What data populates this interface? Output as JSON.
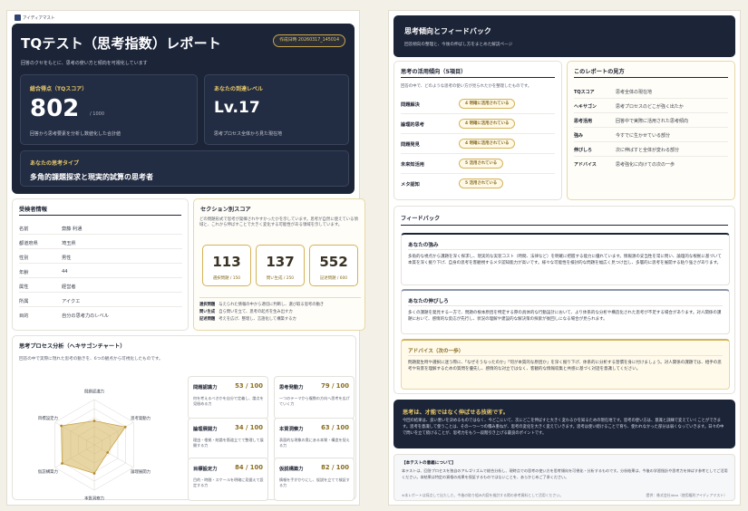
{
  "brand": "アイディアマスト",
  "report": {
    "title": "TQテスト（思考指数）レポート",
    "subtitle": "回答のクセをもとに、思考の使い方と傾向を可視化しています",
    "badge": "作成日時 20260317_145014"
  },
  "score": {
    "label": "総合得点（TQスコア）",
    "value": "802",
    "max": "/ 1000",
    "note": "回答から思考要素を分析し数値化した合計値"
  },
  "level": {
    "label": "あなたの到達レベル",
    "value": "Lv.17",
    "note": "思考プロセス全体から見た現在地"
  },
  "type": {
    "label": "あなたの思考タイプ",
    "value": "多角的課題探求と現実的試算の思考者"
  },
  "profile": {
    "title": "受検者情報",
    "rows": [
      {
        "k": "名前",
        "v": "齋藤 利通"
      },
      {
        "k": "都道府県",
        "v": "埼玉県"
      },
      {
        "k": "性別",
        "v": "男性"
      },
      {
        "k": "年齢",
        "v": "44"
      },
      {
        "k": "属性",
        "v": "経営者"
      },
      {
        "k": "所属",
        "v": "アイクエ"
      },
      {
        "k": "目的",
        "v": "自分の思考力のレベル"
      }
    ]
  },
  "sections": {
    "title": "セクション別スコア",
    "desc": "どの問題形式で思考が発揮されやすかったかを示しています。思考が自然に使えている領域と、これから伸ばすことで大きく変化する可能性がある領域を示しています。",
    "items": [
      {
        "value": "113",
        "label": "選択問題 / 150"
      },
      {
        "value": "137",
        "label": "問い生成 / 250"
      },
      {
        "value": "552",
        "label": "記述問題 / 600"
      }
    ],
    "notes": [
      {
        "k": "選択問題",
        "v": "与えられた情報の中から適切に判断し、選び取る思考の動き"
      },
      {
        "k": "問い生成",
        "v": "自ら問いを立て、思考の起点を生み出す力"
      },
      {
        "k": "記述問題",
        "v": "考えを広げ、整理し、言語化して構築する力"
      }
    ]
  },
  "hexagon": {
    "title": "思考プロセス分析（ヘキサゴンチャート）",
    "desc": "回答の中で実際に現れた思考の動きを、6つの観点から可視化したものです。",
    "axes": [
      "問題認識力",
      "思考発動力",
      "論理展開力",
      "本質洞察力",
      "仮説構築力",
      "目標設定力"
    ],
    "cards": [
      {
        "t": "問題認識力",
        "s": "53 / 100",
        "d": "何を考えるべきかを自分で定義し、論点を見極める力"
      },
      {
        "t": "思考発動力",
        "s": "79 / 100",
        "d": "一つのテーマから複数の方向へ思考を広げていく力"
      },
      {
        "t": "論理展開力",
        "s": "34 / 100",
        "d": "理由・根拠・結論を筋道立てて整理して展開する力"
      },
      {
        "t": "本質洞察力",
        "s": "63 / 100",
        "d": "表面的な現象の奥にある本質・構造を捉える力"
      },
      {
        "t": "目標設定力",
        "s": "84 / 100",
        "d": "目的・時間・スケールを明確に見据えて設定する力"
      },
      {
        "t": "仮説構築力",
        "s": "82 / 100",
        "d": "情報を手がかりにし、仮説を立てて検証する力"
      }
    ]
  },
  "chart_data": {
    "type": "radar",
    "categories": [
      "問題認識力",
      "思考発動力",
      "論理展開力",
      "本質洞察力",
      "仮説構築力",
      "目標設定力"
    ],
    "values": [
      53,
      79,
      34,
      63,
      82,
      84
    ],
    "ylim": [
      0,
      100
    ]
  },
  "right": {
    "title": "思考傾向とフィードバック",
    "subtitle": "回答傾向の整理と、今後の伸ばし方をまとめた解説ページ"
  },
  "trend": {
    "title": "思考の活用傾向（5項目）",
    "desc": "回答の中で、どのような思考の使い方が見られたかを整理したものです。",
    "rows": [
      {
        "k": "問題解決",
        "v": "4 明確に活用されている"
      },
      {
        "k": "論理的思考",
        "v": "4 明確に活用されている"
      },
      {
        "k": "問題発見",
        "v": "4 明確に活用されている"
      },
      {
        "k": "未来知活用",
        "v": "5 活用されている"
      },
      {
        "k": "メタ認知",
        "v": "5 活用されている"
      }
    ]
  },
  "guide": {
    "title": "このレポートの見方",
    "rows": [
      {
        "k": "TQスコア",
        "v": "思考全体の現在地"
      },
      {
        "k": "ヘキサゴン",
        "v": "思考プロセスのどこが強く出たか"
      },
      {
        "k": "思考活用",
        "v": "回答中で実際に活用された思考傾向"
      },
      {
        "k": "強み",
        "v": "今すでに生かせている部分"
      },
      {
        "k": "伸びしろ",
        "v": "次に伸ばすと全体が変わる部分"
      },
      {
        "k": "アドバイス",
        "v": "思考強化に向けての次の一歩"
      }
    ]
  },
  "feedback": {
    "title": "フィードバック",
    "strength": {
      "h": "あなたの強み",
      "b": "多角的な視点から課題を深く探求し、現実的な実装コスト（時間、法律など）を明確に把握する能力に優れています。情報源の妥当性を常に問い、論理的な根拠に基づいて本質を深く掘り下げ、自身の思考を客観視するメタ認知能力が高いです。様々な可能性を検討的な問題を幅広く見つけ出し、多層的に思考を展開する粘り強さがあります。"
    },
    "growth": {
      "h": "あなたの伸びしろ",
      "b": "多くの課題を発見する一方で、問題の根本原因を特定する際の具体的な行動設計において、より体系的な分析や構造化された思考が不足する場合があります。対人関係の課題において、感情的な反応が先行し、状況の理解や建設的な解決策の探索が後回しになる場合が見られます。"
    },
    "advice": {
      "h": "アドバイス（次の一歩）",
      "b": "問題発生時や選択に迷う際に、「なぜそうなったのか」「何が本質的な原因か」を深く掘り下げ、体系的に分析する習慣を身に付けましょう。対人関係の課題では、相手の思考や背景を理解するための質問を優先し、感情的な対立ではなく、客観的な情報収集と共感に基づく対話を意識してください。"
    }
  },
  "quote": {
    "h": "思考は、才能ではなく伸ばせる技術です。",
    "b": "今回の結果は、良い悪いを決めるものではなく、今どこにいて、次にどこを伸ばすと大きく変わるかを知るための現在地です。思考の使い方は、意識と訓練で変えていくことができます。思考を意識して使うことは、その一つ一つの積み重ねが、思考の変化を大きく変えていきます。思考は使い続けることで育ち、使われなかった部分は弱くなっていきます。日々の中で問いを立て続けることが、思考力をもう一段階引き上げる最良のポイントです。"
  },
  "note": {
    "h": "【本テストの意義について】",
    "b": "本テストは、回答プロセスを独自のアルゴリズムで総合分析し、現時点での思考の使い方を思考傾向を可視化・分析するものです。分析結果は、今後の学習指針や思考力を伸ばす参考としてご活用ください。本結果は特定の資格の成果を保証するものではないことを、あらかじめご了承ください。",
    "footer": "※本レポートは採点して出たした、今後の取り組み内容を検討する際の参考資料として活用ください。",
    "copyright": "提供：株式会社idea（使用権利アイディアマスト）"
  }
}
